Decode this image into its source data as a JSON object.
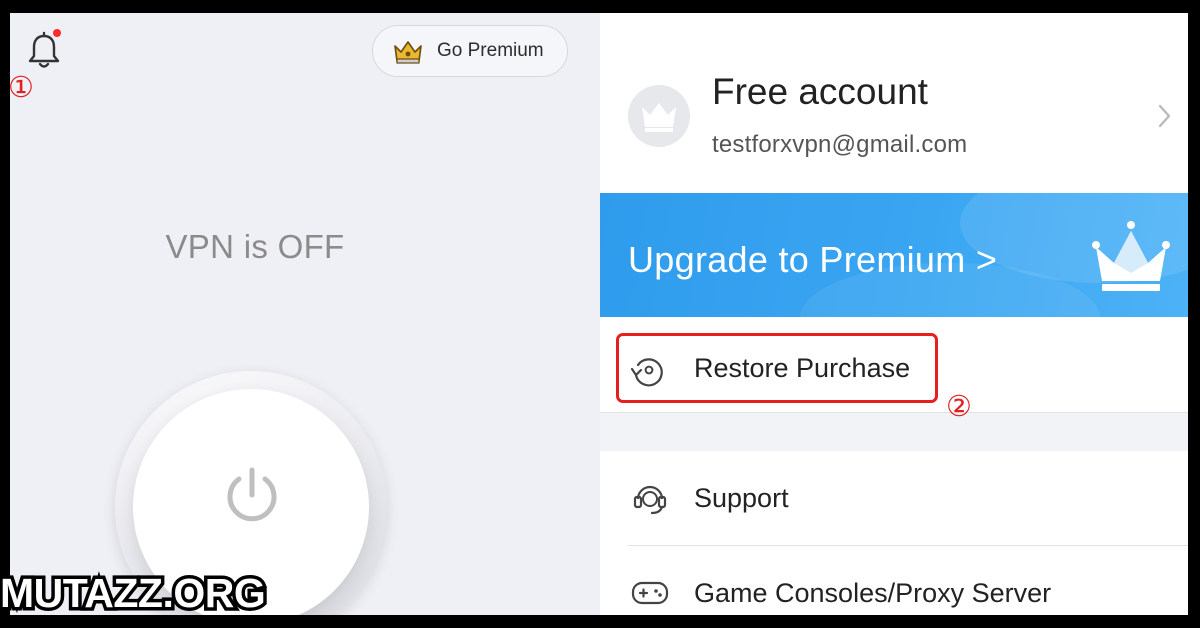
{
  "left_panel": {
    "annotation_marker": "①",
    "go_premium_label": "Go Premium",
    "vpn_status": "VPN is OFF"
  },
  "right_panel": {
    "account": {
      "title": "Free account",
      "email": "testforxvpn@gmail.com"
    },
    "upgrade_banner": "Upgrade to Premium >",
    "restore_purchase_label": "Restore Purchase",
    "annotation_marker": "②",
    "menu_items": [
      {
        "label": "Support",
        "icon": "support-headset-icon"
      },
      {
        "label": "Game Consoles/Proxy Server",
        "icon": "gamepad-icon"
      }
    ]
  },
  "watermark": "MUTAZZ.ORG",
  "colors": {
    "accent_blue": "#3aa6f2",
    "highlight_red": "#e61e1e",
    "notification_dot": "#ff2a2a",
    "premium_gold": "#e9b730"
  },
  "icons": {
    "bell": "bell-icon",
    "crown": "crown-icon",
    "power": "power-icon",
    "chevron": "chevron-right-icon",
    "restore": "restore-icon"
  }
}
